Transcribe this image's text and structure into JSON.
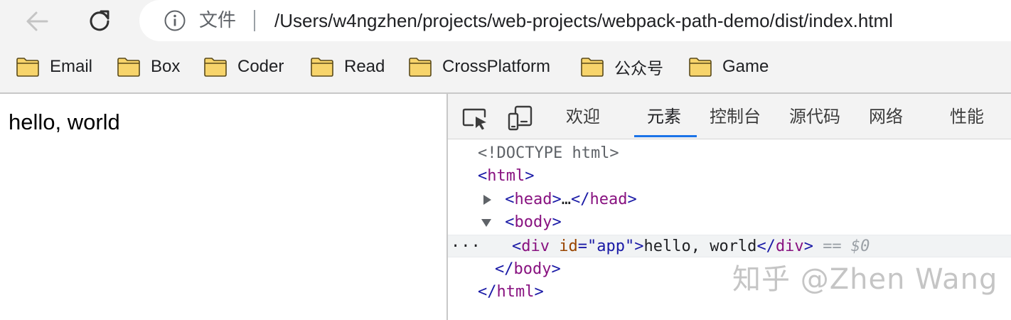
{
  "toolbar": {
    "back_icon": "arrow-left-icon",
    "reload_icon": "reload-icon",
    "address": {
      "info_icon": "info-icon",
      "scheme_label": "文件",
      "url": "/Users/w4ngzhen/projects/web-projects/webpack-path-demo/dist/index.html"
    }
  },
  "bookmarks": {
    "icon": "folder-icon",
    "folder_color": "#f7d46b",
    "items": [
      {
        "label": "Email"
      },
      {
        "label": "Box"
      },
      {
        "label": "Coder"
      },
      {
        "label": "Read"
      },
      {
        "label": "CrossPlatform"
      },
      {
        "label": "公众号"
      },
      {
        "label": "Game"
      }
    ]
  },
  "page": {
    "content_text": "hello, world"
  },
  "devtools": {
    "inspect_icon": "inspect-element-icon",
    "device_icon": "device-toolbar-icon",
    "accent_color": "#1a73e8",
    "tabs": [
      {
        "label": "欢迎"
      },
      {
        "label": "元素",
        "active": true
      },
      {
        "label": "控制台"
      },
      {
        "label": "源代码"
      },
      {
        "label": "网络"
      },
      {
        "label": "性能"
      }
    ],
    "dom": {
      "doctype": "<!DOCTYPE html>",
      "html_open": "html",
      "head_tag": "head",
      "head_ellipsis": "…",
      "body_tag": "body",
      "div_tag": "div",
      "div_attr_name": "id",
      "div_attr_value": "\"app\"",
      "div_text": "hello, world",
      "selected_ref": "== $0",
      "row_menu": "···",
      "body_close": "body",
      "html_close": "html"
    }
  },
  "watermark": "知乎 @Zhen Wang"
}
